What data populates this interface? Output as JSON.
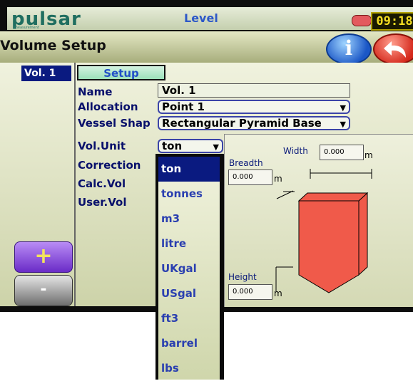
{
  "titlebar": {
    "logo": "pulsar",
    "logo_tagline": "measurement",
    "title": "Level",
    "clock": "09:18"
  },
  "header": {
    "title": "Volume Setup",
    "info_label": "i"
  },
  "sidebar": {
    "items": [
      {
        "label": "Vol. 1"
      }
    ],
    "add_label": "+",
    "remove_label": "-"
  },
  "tabs": {
    "setup": "Setup"
  },
  "form": {
    "name_label": "Name",
    "name_value": "Vol.  1",
    "allocation_label": "Allocation",
    "allocation_value": "Point 1",
    "vessel_label": "Vessel Shap",
    "vessel_value": "Rectangular Pyramid Base",
    "volunit_label": "Vol.Unit",
    "volunit_value": "ton",
    "correction_label": "Correction",
    "calcvol_label": "Calc.Vol",
    "uservol_label": "User.Vol"
  },
  "diagram": {
    "width_label": "Width",
    "width_value": "0.000",
    "width_unit": "m",
    "breadth_label": "Breadth",
    "breadth_value": "0.000",
    "breadth_unit": "m",
    "height_label": "Height",
    "height_value": "0.000",
    "height_unit": "m",
    "vessel_color": "#f05a4a"
  },
  "dropdown": {
    "options": [
      "ton",
      "tonnes",
      "m3",
      "litre",
      "UKgal",
      "USgal",
      "ft3",
      "barrel",
      "lbs"
    ],
    "selected": "ton"
  },
  "colors": {
    "accent": "#0a1a80",
    "label_text": "#08106b",
    "clock_text": "#f6df22"
  }
}
